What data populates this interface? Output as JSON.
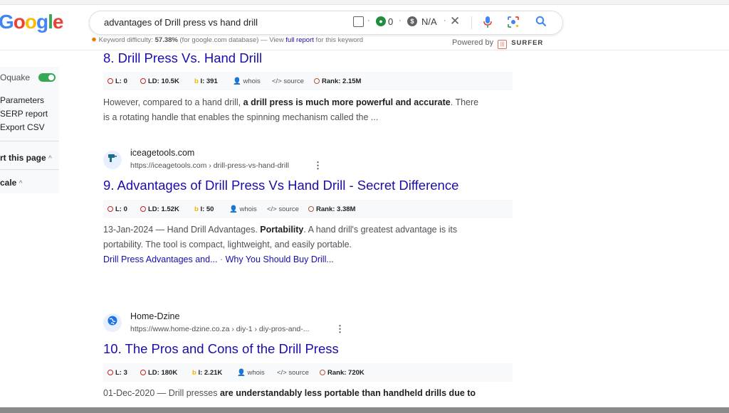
{
  "logo": {
    "letters": [
      "G",
      "o",
      "o",
      "g",
      "l",
      "e"
    ],
    "colors": [
      "#4285f4",
      "#ea4335",
      "#fbbc05",
      "#4285f4",
      "#34a853",
      "#ea4335"
    ]
  },
  "search": {
    "query": "advantages of Drill press vs hand drill",
    "counter_value": "0",
    "price_value": "N/A",
    "dot": "·",
    "clear_icon": "close-icon",
    "mic_icon": "mic-icon",
    "lens_icon": "camera-lens-icon",
    "search_icon": "search-icon"
  },
  "keyword_bar": {
    "label": "Keyword difficulty:",
    "value": "57.38%",
    "suffix": "(for google.com database) — View",
    "link": "full report",
    "tail": "for this keyword"
  },
  "powered": {
    "label": "Powered by",
    "badge": "|||",
    "brand": "SURFER"
  },
  "sidebar": {
    "oquake": "Oquake",
    "items": [
      "Parameters",
      "SERP report",
      "Export CSV"
    ],
    "about": "rt this page",
    "scale": "cale",
    "chevron": "^"
  },
  "results": [
    {
      "title": "8. Drill Press Vs. Hand Drill",
      "metrics": {
        "l": "L: 0",
        "ld": "LD: 10.5K",
        "i": "I: 391",
        "whois": "whois",
        "source": "source",
        "rank": "Rank: 2.15M"
      },
      "snippet": {
        "line1_a": "However, compared to a hand drill, ",
        "line1_b": "a drill press is much more powerful and accurate",
        "line1_c": ". There",
        "line2": "is a rotating handle that enables the spinning mechanism called the ..."
      }
    },
    {
      "site": "iceagetools.com",
      "url": "https://iceagetools.com › drill-press-vs-hand-drill",
      "title": "9. Advantages of Drill Press Vs Hand Drill - Secret Difference",
      "metrics": {
        "l": "L: 0",
        "ld": "LD: 1.52K",
        "i": "I: 50",
        "whois": "whois",
        "source": "source",
        "rank": "Rank: 3.38M"
      },
      "snippet": {
        "line1_a": "13-Jan-2024 — Hand Drill Advantages. ",
        "line1_b": "Portability",
        "line1_c": ". A hand drill's greatest advantage is its",
        "line2": "portability. The tool is compact, lightweight, and easily portable."
      },
      "sitelinks": [
        "Drill Press Advantages and...",
        "Why You Should Buy Drill..."
      ],
      "sitelink_sep": " · "
    },
    {
      "site": "Home-Dzine",
      "url": "https://www.home-dzine.co.za › diy-1 › diy-pros-and-...",
      "title": "10. The Pros and Cons of the Drill Press",
      "metrics": {
        "l": "L: 3",
        "ld": "LD: 180K",
        "i": "I: 2.21K",
        "whois": "whois",
        "source": "source",
        "rank": "Rank: 720K"
      },
      "snippet": {
        "line1_a": "01-Dec-2020 — Drill presses ",
        "line1_b": "are understandably less portable than handheld drills due to"
      }
    }
  ]
}
